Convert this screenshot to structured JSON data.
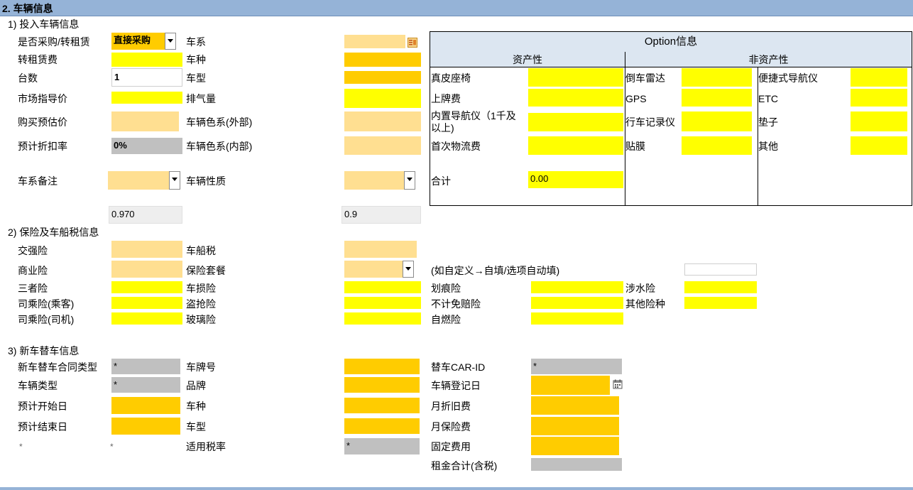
{
  "section_title": "2. 车辆信息",
  "s1": {
    "title": "1) 投入车辆信息",
    "purchase_label": "是否采购/转租赁",
    "purchase_value": "直接采购",
    "sublease_label": "转租赁费",
    "qty_label": "台数",
    "qty_value": "1",
    "msrp_label": "市场指导价",
    "buy_price_label": "购买预估价",
    "discount_label": "预计折扣率",
    "discount_value": "0%",
    "series_note_label": "车系备注",
    "factor1": "0.970",
    "series_label": "车系",
    "kind_label": "车种",
    "model_label": "车型",
    "displacement_label": "排气量",
    "color_ext_label": "车辆色系(外部)",
    "color_int_label": "车辆色系(内部)",
    "nature_label": "车辆性质",
    "factor2": "0.9"
  },
  "option": {
    "title": "Option信息",
    "asset_header": "资产性",
    "nonasset_header": "非资产性",
    "asset_items": [
      "真皮座椅",
      "上牌费",
      "内置导航仪（1千及以上)",
      "首次物流费"
    ],
    "total_label": "合计",
    "total_value": "0.00",
    "nonasset_col1": [
      "倒车雷达",
      "GPS",
      "行车记录仪",
      "贴膜"
    ],
    "nonasset_col2": [
      "便捷式导航仪",
      "ETC",
      "垫子",
      "其他"
    ]
  },
  "s2": {
    "title": "2) 保险及车船税信息",
    "compulsory_label": "交强险",
    "commercial_label": "商业险",
    "third_party_label": "三者险",
    "passenger_label": "司乘险(乘客)",
    "driver_label": "司乘险(司机)",
    "vessel_tax_label": "车船税",
    "package_label": "保险套餐",
    "damage_label": "车损险",
    "theft_label": "盗抢险",
    "glass_label": "玻璃险",
    "custom_note": "(如自定义→自填/选项自动填)",
    "scratch_label": "划痕险",
    "nondeductible_label": "不计免赔险",
    "selfignite_label": "自燃险",
    "water_label": "涉水险",
    "other_label": "其他险种"
  },
  "s3": {
    "title": "3) 新车替车信息",
    "contract_type_label": "新车替车合同类型",
    "contract_type_value": "*",
    "vehicle_type_label": "车辆类型",
    "vehicle_type_value": "*",
    "start_label": "预计开始日",
    "end_label": "预计结束日",
    "star_a": "*",
    "star_b": "*",
    "plate_label": "车牌号",
    "brand_label": "品牌",
    "kind_label": "车种",
    "model_label": "车型",
    "tax_rate_label": "适用税率",
    "tax_rate_value": "*",
    "car_id_label": "替车CAR-ID",
    "car_id_value": "*",
    "reg_date_label": "车辆登记日",
    "depreciation_label": "月折旧费",
    "insurance_fee_label": "月保险费",
    "fixed_cost_label": "固定费用",
    "rent_total_label": "租金合计(含税)"
  },
  "colors": {
    "header": "#95b3d7",
    "yellow": "#ffff00",
    "orange": "#ffcc00",
    "peach": "#ffdf91",
    "gray": "#c0c0c0",
    "option_header": "#dce6f1"
  }
}
